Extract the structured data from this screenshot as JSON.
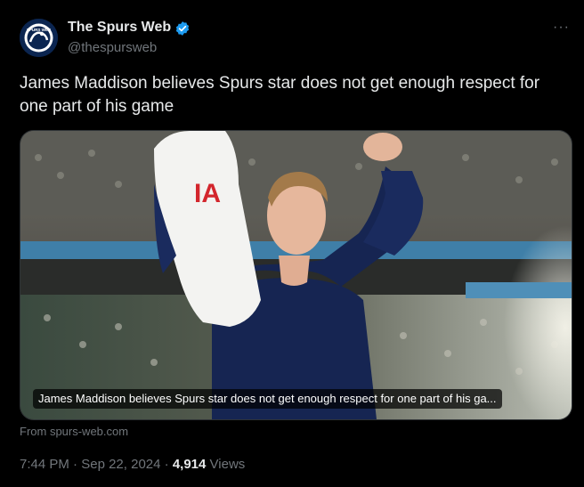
{
  "author": {
    "display_name": "The Spurs Web",
    "handle": "@thespursweb",
    "verified_icon": "verified-badge-icon",
    "avatar_icon": "spurs-web-logo-icon",
    "avatar_logo_text": "SPURS WEB"
  },
  "more_label": "···",
  "post": {
    "text": "James Maddison believes Spurs star does not get enough respect for one part of his game"
  },
  "card": {
    "caption": "James Maddison believes Spurs star does not get enough respect for one part of his ga...",
    "source": "From spurs-web.com"
  },
  "meta": {
    "time": "7:44 PM",
    "sep1": "·",
    "date": "Sep 22, 2024",
    "sep2": "·",
    "views_count": "4,914",
    "views_label": "Views"
  },
  "colors": {
    "background": "#000000",
    "text_primary": "#e7e9ea",
    "text_secondary": "#71767b",
    "verified_blue": "#1d9bf0"
  }
}
